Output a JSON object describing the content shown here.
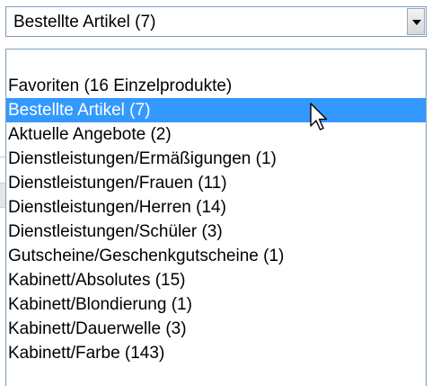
{
  "select": {
    "current_value": "Bestellte Artikel (7)",
    "arrow_icon": "chevron-down-icon"
  },
  "dropdown": {
    "options": [
      "",
      "Favoriten (16 Einzelprodukte)",
      "Bestellte Artikel (7)",
      "Aktuelle Angebote (2)",
      "Dienstleistungen/Ermäßigungen (1)",
      "Dienstleistungen/Frauen (11)",
      "Dienstleistungen/Herren (14)",
      "Dienstleistungen/Schüler (3)",
      "Gutscheine/Geschenkgutscheine (1)",
      "Kabinett/Absolutes (15)",
      "Kabinett/Blondierung (1)",
      "Kabinett/Dauerwelle (3)",
      "Kabinett/Farbe (143)"
    ],
    "selected_option": "Bestellte Artikel (7)"
  },
  "colors": {
    "highlight": "#3399ff",
    "border": "#7f9db9"
  },
  "pointer": {
    "icon": "mouse-pointer-icon"
  }
}
